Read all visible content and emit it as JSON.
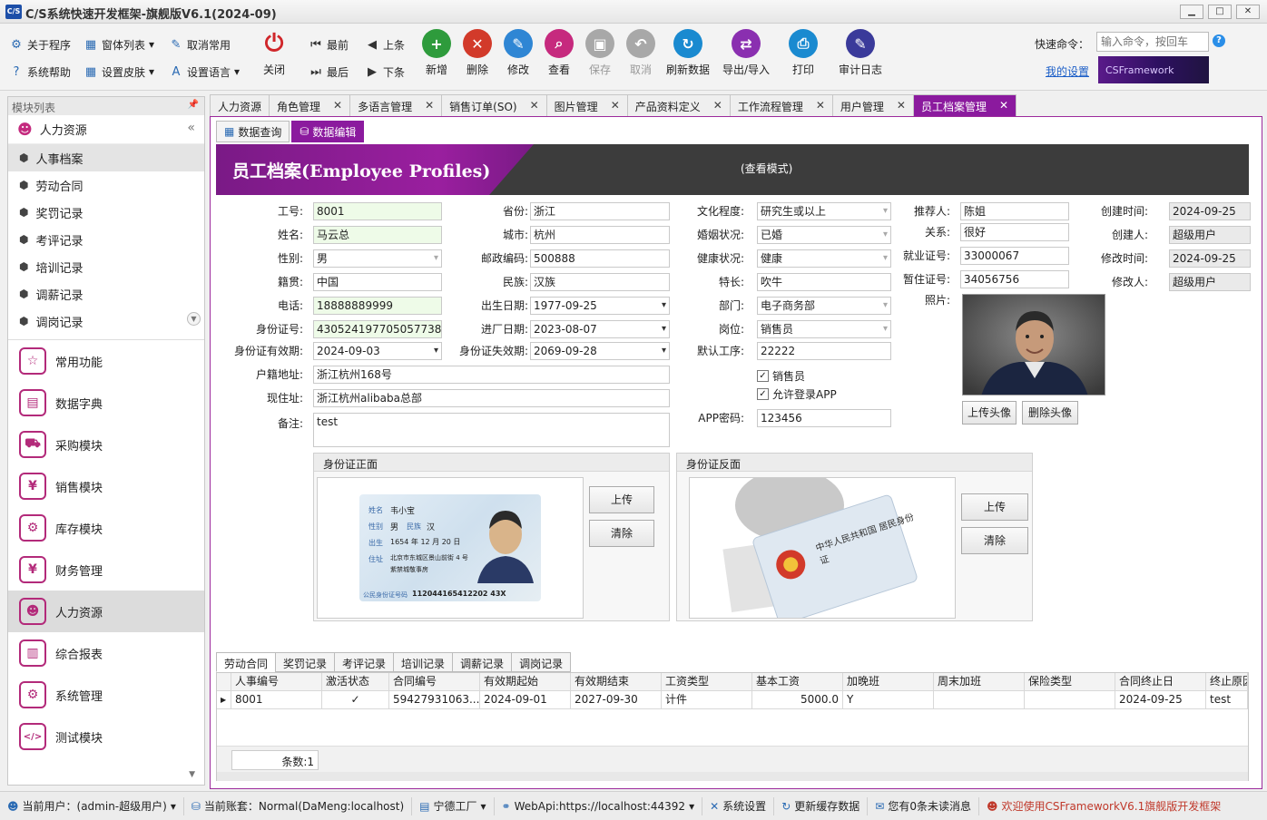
{
  "window": {
    "title": "C/S系统快速开发框架-旗舰版V6.1(2024-09)",
    "icon_text": "C/S"
  },
  "toolbar": {
    "small": [
      {
        "label": "关于程序",
        "icon": "gear-icon",
        "glyph": "⚙"
      },
      {
        "label": "系统帮助",
        "icon": "help-icon",
        "glyph": "?"
      },
      {
        "label": "窗体列表",
        "icon": "windows-icon",
        "glyph": "▦"
      },
      {
        "label": "设置皮肤",
        "icon": "skin-icon",
        "glyph": "▦"
      },
      {
        "label": "取消常用",
        "icon": "unfavorite-icon",
        "glyph": "✎"
      },
      {
        "label": "设置语言",
        "icon": "language-icon",
        "glyph": "A"
      }
    ],
    "nav": [
      {
        "label": "最前",
        "glyph": "⏮"
      },
      {
        "label": "最后",
        "glyph": "⏭"
      },
      {
        "label": "上条",
        "glyph": "◀"
      },
      {
        "label": "下条",
        "glyph": "▶"
      }
    ],
    "close": {
      "label": "关闭",
      "glyph": "⏻"
    },
    "big": [
      {
        "label": "新增",
        "icon": "add-icon",
        "glyph": "+",
        "color": "#2e9b3c"
      },
      {
        "label": "删除",
        "icon": "delete-icon",
        "glyph": "✕",
        "color": "#d23a2a"
      },
      {
        "label": "修改",
        "icon": "edit-icon",
        "glyph": "✎",
        "color": "#2f86d4"
      },
      {
        "label": "查看",
        "icon": "view-icon",
        "glyph": "⌕",
        "color": "#c62a7e"
      },
      {
        "label": "保存",
        "icon": "save-icon",
        "glyph": "▣",
        "color": "#9a9a9a"
      },
      {
        "label": "取消",
        "icon": "undo-icon",
        "glyph": "↶",
        "color": "#9a9a9a"
      },
      {
        "label": "刷新数据",
        "icon": "refresh-icon",
        "glyph": "↻",
        "color": "#1a8ad0"
      },
      {
        "label": "导出/导入",
        "icon": "export-icon",
        "glyph": "⇄",
        "color": "#8a2fb0"
      },
      {
        "label": "打印",
        "icon": "print-icon",
        "glyph": "⎙",
        "color": "#1a8ad0"
      },
      {
        "label": "审计日志",
        "icon": "audit-icon",
        "glyph": "✎",
        "color": "#3a3a9a"
      }
    ],
    "quick_cmd_label": "快速命令：",
    "quick_cmd_placeholder": "输入命令，按回车",
    "my_settings": "我的设置",
    "brand": "CSFramework"
  },
  "sidebar": {
    "header": "模块列表",
    "section": "人力资源",
    "items": [
      "人事档案",
      "劳动合同",
      "奖罚记录",
      "考评记录",
      "培训记录",
      "调薪记录",
      "调岗记录"
    ],
    "modules": [
      {
        "label": "常用功能",
        "glyph": "☆"
      },
      {
        "label": "数据字典",
        "glyph": "▤"
      },
      {
        "label": "采购模块",
        "glyph": "⛟"
      },
      {
        "label": "销售模块",
        "glyph": "¥"
      },
      {
        "label": "库存模块",
        "glyph": "⚙"
      },
      {
        "label": "财务管理",
        "glyph": "¥"
      },
      {
        "label": "人力资源",
        "glyph": "☻"
      },
      {
        "label": "综合报表",
        "glyph": "▥"
      },
      {
        "label": "系统管理",
        "glyph": "⚙"
      },
      {
        "label": "测试模块",
        "glyph": "</>"
      }
    ]
  },
  "doc_tabs": [
    "人力资源",
    "角色管理",
    "多语言管理",
    "销售订单(SO)",
    "图片管理",
    "产品资料定义",
    "工作流程管理",
    "用户管理",
    "员工档案管理"
  ],
  "sub_tabs": [
    "数据查询",
    "数据编辑"
  ],
  "banner": {
    "title": "员工档案(Employee Profiles)",
    "mode": "(查看模式)"
  },
  "form": {
    "emp_no_label": "工号:",
    "emp_no": "8001",
    "name_label": "姓名:",
    "name": "马云总",
    "gender_label": "性别:",
    "gender": "男",
    "native_label": "籍贯:",
    "native": "中国",
    "phone_label": "电话:",
    "phone": "18888889999",
    "idno_label": "身份证号:",
    "idno": "430524197705057738",
    "idvalid_label": "身份证有效期:",
    "idvalid": "2024-09-03",
    "hukou_label": "户籍地址:",
    "hukou": "浙江杭州168号",
    "addr_label": "现住址:",
    "addr": "浙江杭州alibaba总部",
    "remark_label": "备注:",
    "remark": "test",
    "province_label": "省份:",
    "province": "浙江",
    "city_label": "城市:",
    "city": "杭州",
    "zip_label": "邮政编码:",
    "zip": "500888",
    "nation_label": "民族:",
    "nation": "汉族",
    "birth_label": "出生日期:",
    "birth": "1977-09-25",
    "join_label": "进厂日期:",
    "join": "2023-08-07",
    "idexpire_label": "身份证失效期:",
    "idexpire": "2069-09-28",
    "edu_label": "文化程度:",
    "edu": "研究生或以上",
    "marital_label": "婚姻状况:",
    "marital": "已婚",
    "health_label": "健康状况:",
    "health": "健康",
    "skill_label": "特长:",
    "skill": "吹牛",
    "dept_label": "部门:",
    "dept": "电子商务部",
    "post_label": "岗位:",
    "post": "销售员",
    "proc_label": "默认工序:",
    "proc": "22222",
    "is_sales_label": "销售员",
    "allow_app_label": "允许登录APP",
    "app_pwd_label": "APP密码:",
    "app_pwd": "123456",
    "referrer_label": "推荐人:",
    "referrer": "陈姐",
    "relation_label": "关系:",
    "relation": "很好",
    "work_cert_label": "就业证号:",
    "work_cert": "33000067",
    "temp_cert_label": "暂住证号:",
    "temp_cert": "34056756",
    "photo_label": "照片:",
    "upload_avatar": "上传头像",
    "delete_avatar": "删除头像",
    "created_time_label": "创建时间:",
    "created_time": "2024-09-25",
    "creator_label": "创建人:",
    "creator": "超级用户",
    "modified_time_label": "修改时间:",
    "modified_time": "2024-09-25",
    "modifier_label": "修改人:",
    "modifier": "超级用户"
  },
  "id_front": {
    "title": "身份证正面",
    "upload": "上传",
    "clear": "清除",
    "card_name": "韦小宝",
    "card_gender": "男",
    "card_nation": "汉",
    "card_birth": "1654 年 12 月 20 日",
    "card_addr1": "北京市东城区景山前街 4 号",
    "card_addr2": "紫禁城敬事房",
    "card_no_label": "公民身份证号码",
    "card_no": "112044165412202 43X"
  },
  "id_back": {
    "title": "身份证反面",
    "upload": "上传",
    "clear": "清除",
    "card_text": "中华人民共和国 居民身份证"
  },
  "bottom_tabs": [
    "劳动合同",
    "奖罚记录",
    "考评记录",
    "培训记录",
    "调薪记录",
    "调岗记录"
  ],
  "grid": {
    "columns": [
      "人事编号",
      "激活状态",
      "合同编号",
      "有效期起始",
      "有效期结束",
      "工资类型",
      "基本工资",
      "加晚班",
      "周末加班",
      "保险类型",
      "合同终止日",
      "终止原因"
    ],
    "rows": [
      [
        "8001",
        "✓",
        "59427931063...",
        "2024-09-01",
        "2027-09-30",
        "计件",
        "5000.0",
        "Y",
        "",
        "",
        "2024-09-25",
        "test"
      ]
    ],
    "footer": "条数:1"
  },
  "status": {
    "user": "当前用户：(admin-超级用户)",
    "account": "当前账套：Normal(DaMeng:localhost)",
    "factory": "宁德工厂",
    "webapi": "WebApi:https://localhost:44392",
    "settings": "系统设置",
    "cache": "更新缓存数据",
    "messages": "您有0条未读消息",
    "welcome": "欢迎使用CSFrameworkV6.1旗舰版开发框架"
  }
}
